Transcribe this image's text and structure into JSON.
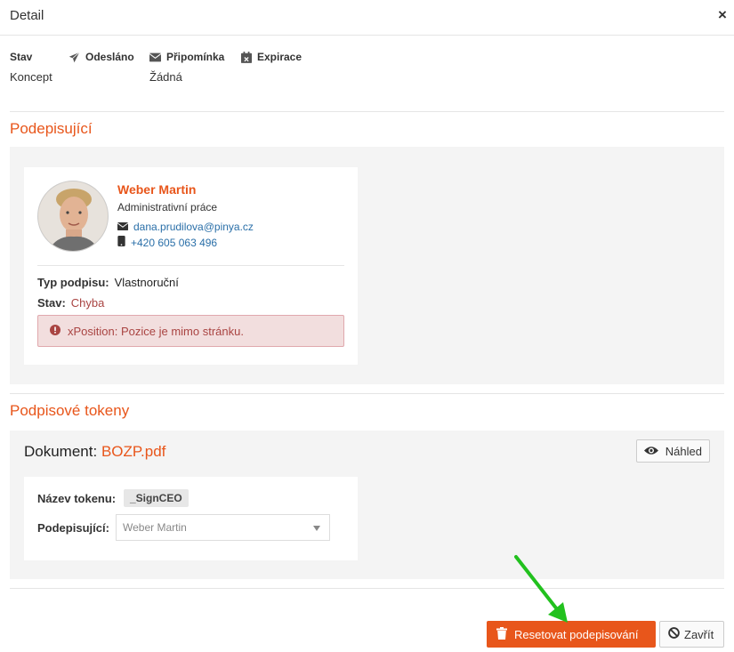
{
  "dialog": {
    "title": "Detail",
    "close_glyph": "×"
  },
  "status": {
    "state_label": "Stav",
    "state_value": "Koncept",
    "sent_label": "Odesláno",
    "sent_value": "",
    "reminder_label": "Připomínka",
    "reminder_value": "Žádná",
    "expiry_label": "Expirace",
    "expiry_value": ""
  },
  "signers": {
    "section_title": "Podepisující",
    "items": [
      {
        "name": "Weber Martin",
        "role": "Administrativní práce",
        "email": "dana.prudilova@pinya.cz",
        "phone": "+420 605 063 496",
        "sign_type_label": "Typ podpisu:",
        "sign_type_value": "Vlastnoruční",
        "state_label": "Stav:",
        "state_value": "Chyba",
        "error_message": "xPosition: Pozice je mimo stránku."
      }
    ]
  },
  "tokens": {
    "section_title": "Podpisové tokeny",
    "document_label": "Dokument:",
    "document_name": "BOZP.pdf",
    "preview_label": "Náhled",
    "token_name_label": "Název tokenu:",
    "token_name_value": "_SignCEO",
    "signer_label": "Podepisující:",
    "signer_select_value": "Weber Martin"
  },
  "footer": {
    "reset_label": "Resetovat podepisování",
    "close_label": "Zavřít"
  },
  "colors": {
    "accent": "#e8561b",
    "link": "#2a6fa8",
    "error_text": "#a94442",
    "error_bg": "#f2dede",
    "annotation_arrow": "#22c11e"
  },
  "icons": {
    "sent": "paper-plane-icon",
    "reminder": "envelope-icon",
    "expiry": "calendar-x-icon",
    "email": "envelope-icon",
    "phone": "mobile-icon",
    "error": "exclamation-circle-icon",
    "preview": "eye-icon",
    "reset": "trash-icon",
    "close": "ban-icon"
  }
}
